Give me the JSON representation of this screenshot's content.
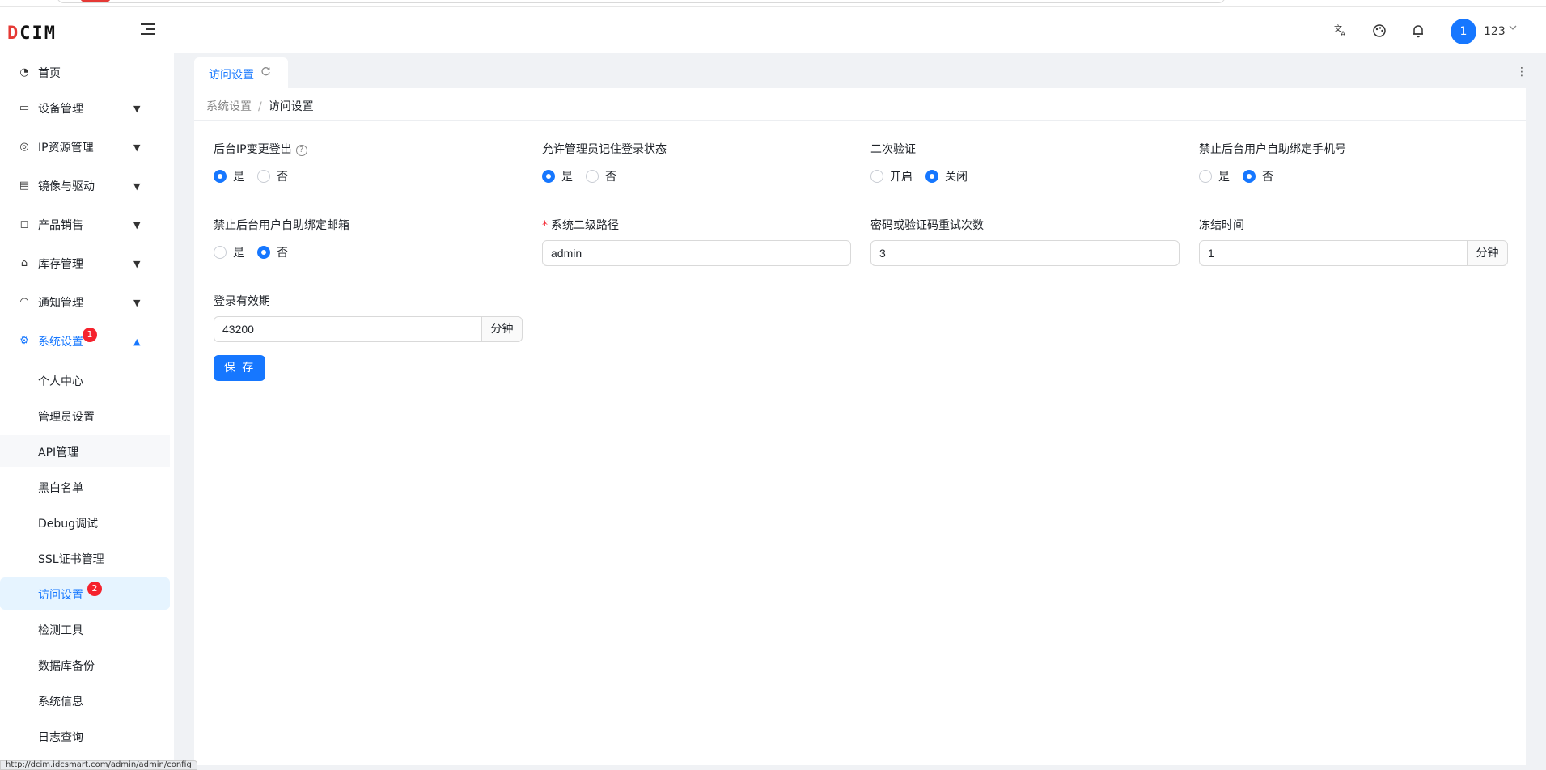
{
  "header": {
    "logo_text": "DCIM",
    "user_avatar": "1",
    "user_name": "123"
  },
  "sidebar": {
    "items": [
      {
        "label": "首页",
        "icon": "dashboard-icon"
      },
      {
        "label": "设备管理",
        "icon": "monitor-icon"
      },
      {
        "label": "IP资源管理",
        "icon": "network-icon"
      },
      {
        "label": "镜像与驱动",
        "icon": "image-icon"
      },
      {
        "label": "产品销售",
        "icon": "bag-icon"
      },
      {
        "label": "库存管理",
        "icon": "warehouse-icon"
      },
      {
        "label": "通知管理",
        "icon": "bell-icon"
      },
      {
        "label": "系统设置",
        "icon": "gear-icon",
        "badge": "1"
      }
    ],
    "sub_items": [
      {
        "label": "个人中心"
      },
      {
        "label": "管理员设置"
      },
      {
        "label": "API管理"
      },
      {
        "label": "黑白名单"
      },
      {
        "label": "Debug调试"
      },
      {
        "label": "SSL证书管理"
      },
      {
        "label": "访问设置",
        "badge": "2"
      },
      {
        "label": "检测工具"
      },
      {
        "label": "数据库备份"
      },
      {
        "label": "系统信息"
      },
      {
        "label": "日志查询"
      }
    ]
  },
  "tabs": [
    {
      "label": "访问设置"
    }
  ],
  "breadcrumb": {
    "parent": "系统设置",
    "separator": "/",
    "current": "访问设置"
  },
  "form": {
    "ip_logout": {
      "label": "后台IP变更登出",
      "options": [
        "是",
        "否"
      ],
      "selected": "是"
    },
    "remember_login": {
      "label": "允许管理员记住登录状态",
      "options": [
        "是",
        "否"
      ],
      "selected": "是"
    },
    "two_factor": {
      "label": "二次验证",
      "options": [
        "开启",
        "关闭"
      ],
      "selected": "关闭"
    },
    "bind_phone": {
      "label": "禁止后台用户自助绑定手机号",
      "options": [
        "是",
        "否"
      ],
      "selected": "否"
    },
    "bind_email": {
      "label": "禁止后台用户自助绑定邮箱",
      "options": [
        "是",
        "否"
      ],
      "selected": "否"
    },
    "admin_path": {
      "label": "系统二级路径",
      "required_mark": "*",
      "value": "admin"
    },
    "retry_count": {
      "label": "密码或验证码重试次数",
      "value": "3"
    },
    "freeze_time": {
      "label": "冻结时间",
      "value": "1",
      "unit": "分钟"
    },
    "login_validity": {
      "label": "登录有效期",
      "value": "43200",
      "unit": "分钟"
    },
    "save_label": "保 存"
  },
  "status_bar": {
    "url": "http://dcim.idcsmart.com/admin/admin/config"
  },
  "colors": {
    "primary": "#1677ff",
    "badge": "#f5222d",
    "logo_accent": "#e53935"
  }
}
